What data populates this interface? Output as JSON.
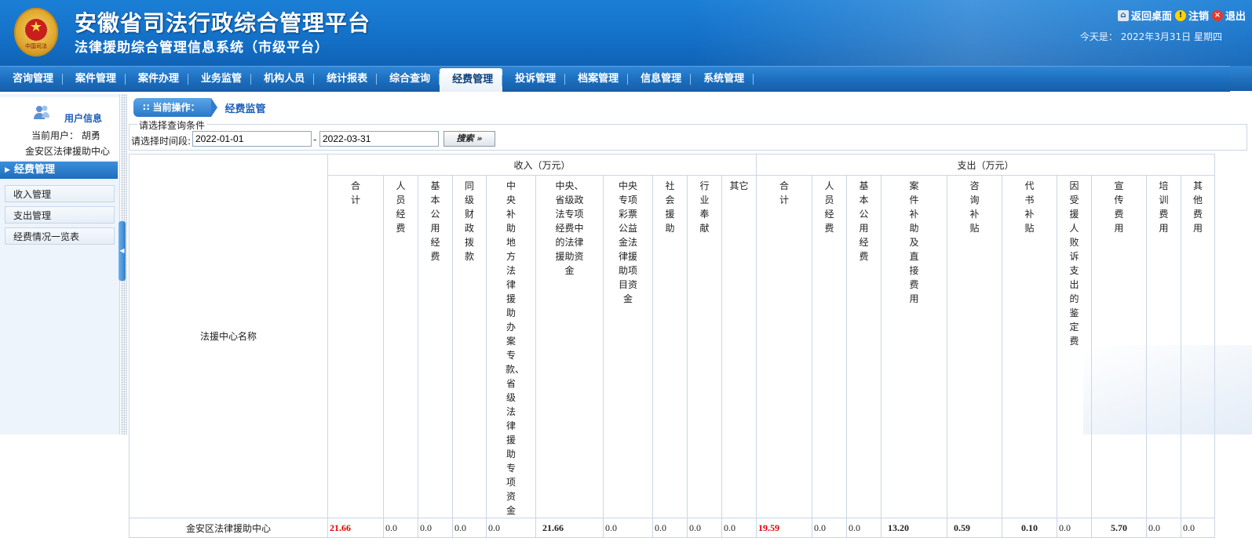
{
  "header": {
    "title": "安徽省司法行政综合管理平台",
    "subtitle": "法律援助综合管理信息系统（市级平台）",
    "emblem_caption": "中国司法",
    "links": {
      "home": "返回桌面",
      "logout": "注销",
      "exit": "退出"
    },
    "date": "今天是：  2022年3月31日  星期四"
  },
  "nav": {
    "items": [
      "咨询管理",
      "案件管理",
      "案件办理",
      "业务监管",
      "机构人员",
      "统计报表",
      "综合查询",
      "经费管理",
      "投诉管理",
      "档案管理",
      "信息管理",
      "系统管理"
    ],
    "active": "经费管理"
  },
  "sidebar": {
    "user_title": "用户信息",
    "current_user": "当前用户：  胡勇",
    "org": "金安区法律援助中心",
    "section": "经费管理",
    "items": [
      "收入管理",
      "支出管理",
      "经费情况一览表"
    ]
  },
  "main": {
    "crumb_label": "当前操作：",
    "crumb_current": "经费监管",
    "query": {
      "legend": "请选择查询条件",
      "label": "请选择时间段:",
      "start": "2022-01-01",
      "end": "2022-03-31",
      "dash": "-",
      "search": "搜索 »"
    },
    "table": {
      "name_header": "法援中心名称",
      "income_header": "收入（万元）",
      "expense_header": "支出（万元）",
      "income_cols": [
        "合计",
        "人员经费",
        "基本公用经费",
        "同级财政拨款",
        "中央补助地方法律援助办案专款、省级法律援助专项资金",
        "中央、省级政法专项经费中的法律援助资金",
        "中央专项彩票公益金法律援助项目资金",
        "社会援助",
        "行业奉献",
        "其它"
      ],
      "expense_cols": [
        "合计",
        "人员经费",
        "基本公用经费",
        "案件补助及直接费用",
        "咨询补贴",
        "代书补贴",
        "因受援人败诉支出的鉴定费",
        "宣传费用",
        "培训费用",
        "其他费用"
      ],
      "rows": [
        {
          "name": "金安区法律援助中心",
          "income": [
            "21.66",
            "0.0",
            "0.0",
            "0.0",
            "0.0",
            "21.66",
            "0.0",
            "0.0",
            "0.0",
            "0.0"
          ],
          "expense": [
            "19.59",
            "0.0",
            "0.0",
            "13.20",
            "0.59",
            "0.10",
            "0.0",
            "5.70",
            "0.0",
            "0.0"
          ]
        }
      ]
    }
  }
}
